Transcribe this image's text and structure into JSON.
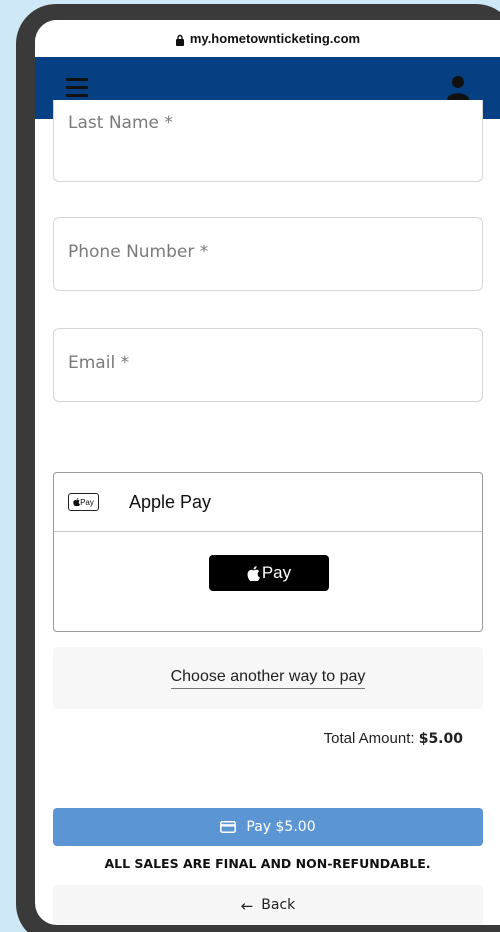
{
  "browser": {
    "url": "my.hometownticketing.com",
    "lock_icon": "lock-icon"
  },
  "header": {
    "background": "#073f83",
    "menu_icon": "hamburger-menu-icon",
    "account_icon": "user-icon"
  },
  "form": {
    "fields": [
      {
        "label": "Last Name *"
      },
      {
        "label": "Phone Number *"
      },
      {
        "label": "Email *"
      }
    ]
  },
  "payment": {
    "option_icon_text": "Pay",
    "option_label": "Apple Pay",
    "button_label": "Pay",
    "alternate_label": "Choose another way to pay"
  },
  "summary": {
    "total_label": "Total Amount:",
    "total_value": "$5.00"
  },
  "actions": {
    "pay_label": "Pay $5.00",
    "pay_color": "#5b95d4",
    "disclaimer": "ALL SALES ARE FINAL AND NON-REFUNDABLE.",
    "back_label": "Back"
  }
}
